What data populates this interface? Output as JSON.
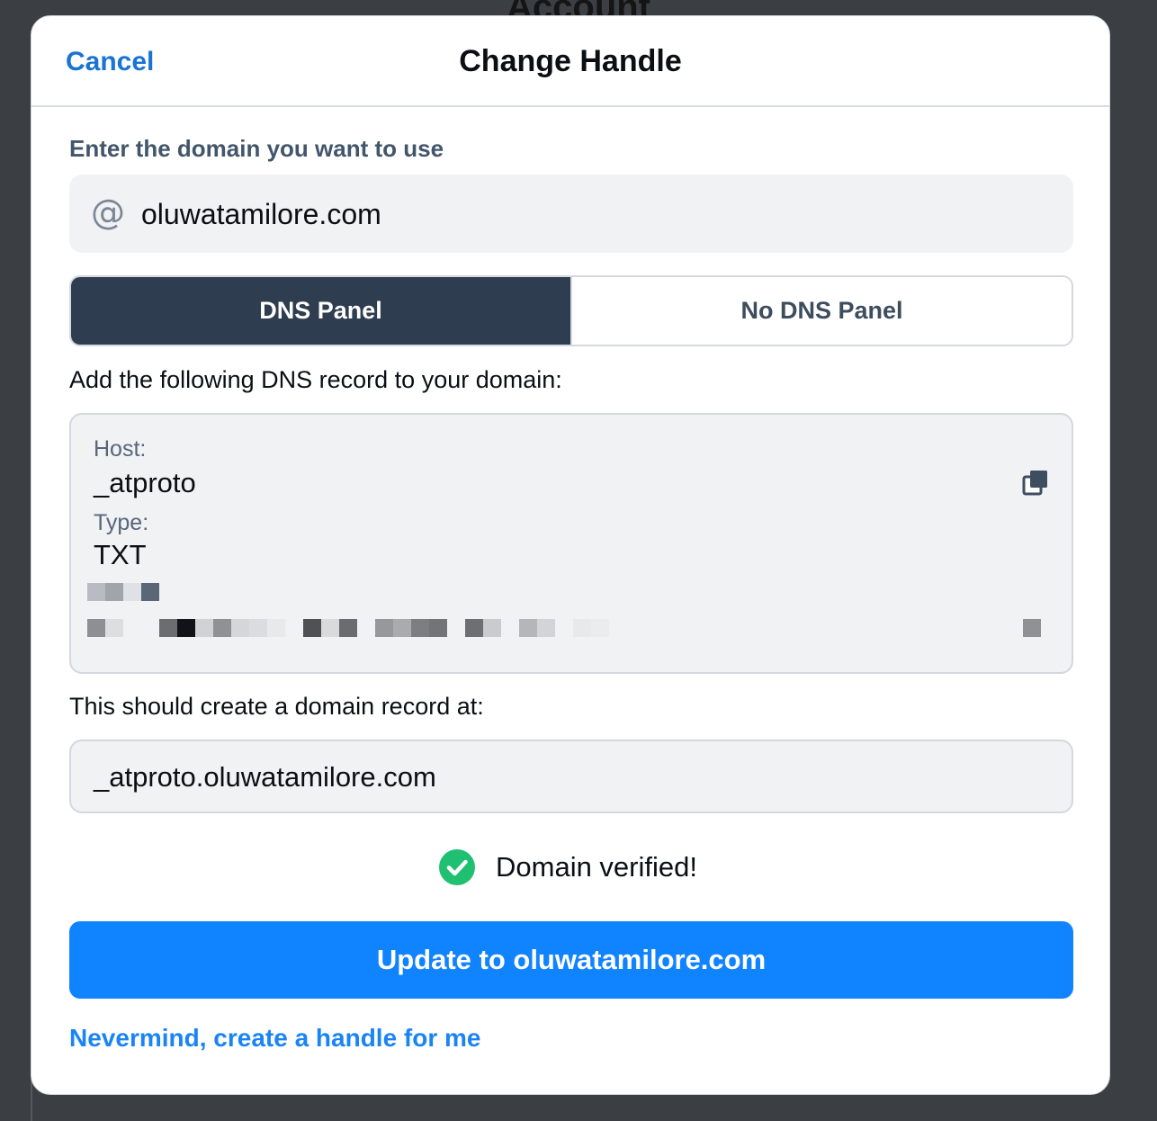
{
  "background": {
    "title": "Account"
  },
  "header": {
    "cancel_label": "Cancel",
    "title": "Change Handle"
  },
  "domain": {
    "label": "Enter the domain you want to use",
    "at_symbol": "@",
    "value": "oluwatamilore.com"
  },
  "tabs": [
    {
      "label": "DNS Panel",
      "active": true
    },
    {
      "label": "No DNS Panel",
      "active": false
    }
  ],
  "instructions": "Add the following DNS record to your domain:",
  "record": {
    "host_label": "Host:",
    "host_value": "_atproto",
    "type_label": "Type:",
    "type_value": "TXT"
  },
  "created": {
    "label": "This should create a domain record at:",
    "value": "_atproto.oluwatamilore.com"
  },
  "status": {
    "text": "Domain verified!",
    "color": "#1fc071"
  },
  "primary_button": {
    "label": "Update to oluwatamilore.com",
    "color": "#1083fe"
  },
  "secondary_link": {
    "label": "Nevermind, create a handle for me"
  },
  "icons": {
    "copy": "copy-icon",
    "check": "check-circle-icon"
  }
}
